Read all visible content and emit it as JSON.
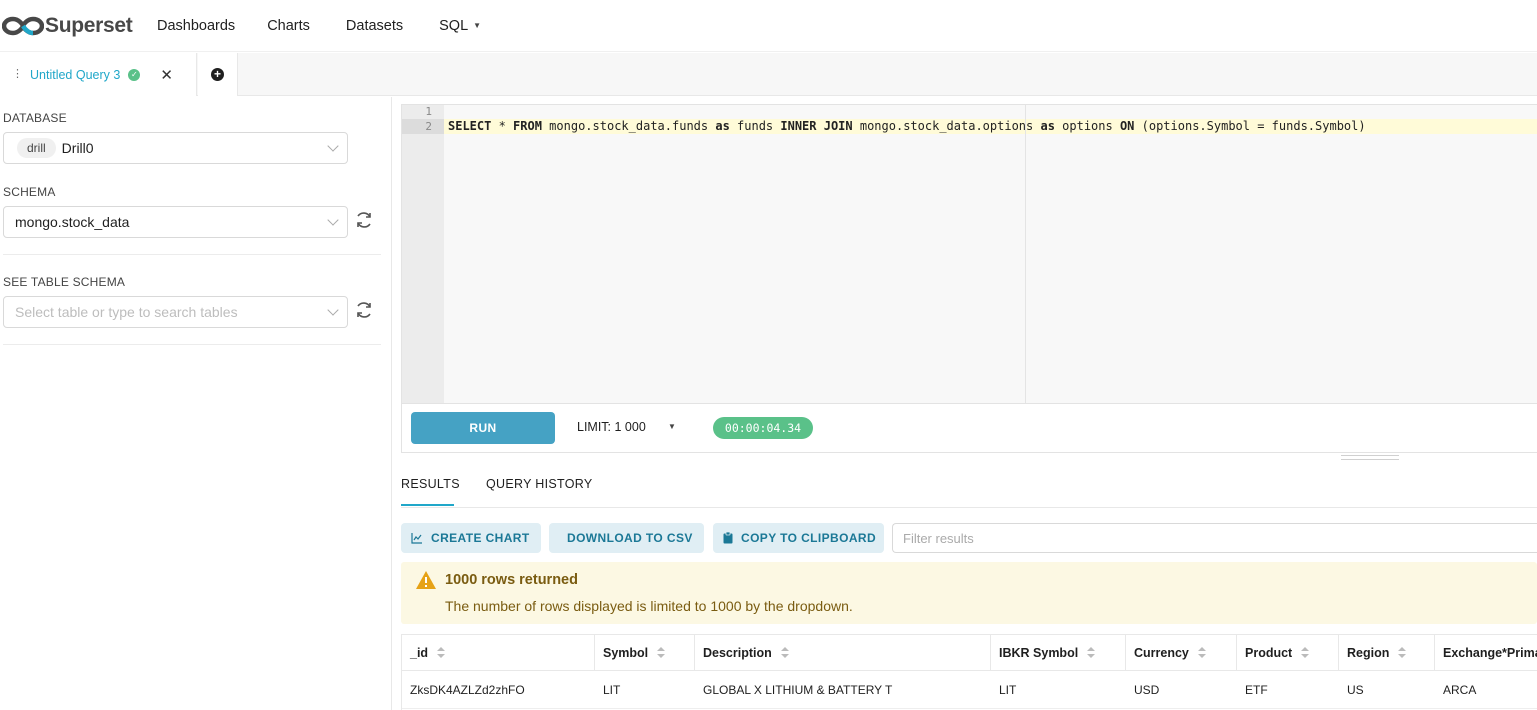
{
  "nav": {
    "brand": "Superset",
    "items": [
      "Dashboards",
      "Charts",
      "Datasets",
      "SQL"
    ]
  },
  "tabs": {
    "query_tab_label": "Untitled Query 3"
  },
  "left": {
    "database_label": "DATABASE",
    "database_tag": "drill",
    "database_name": "Drill0",
    "schema_label": "SCHEMA",
    "schema_value": "mongo.stock_data",
    "table_schema_label": "SEE TABLE SCHEMA",
    "table_placeholder": "Select table or type to search tables"
  },
  "editor": {
    "line_numbers": [
      "1",
      "2"
    ],
    "sql_tokens": [
      {
        "t": "SELECT",
        "kw": true
      },
      {
        "t": " * ",
        "kw": false
      },
      {
        "t": "FROM",
        "kw": true
      },
      {
        "t": " mongo.stock_data.funds ",
        "kw": false
      },
      {
        "t": "as",
        "kw": true
      },
      {
        "t": " funds ",
        "kw": false
      },
      {
        "t": "INNER JOIN",
        "kw": true
      },
      {
        "t": " mongo.stock_data.options ",
        "kw": false
      },
      {
        "t": "as",
        "kw": true
      },
      {
        "t": " options ",
        "kw": false
      },
      {
        "t": "ON",
        "kw": true
      },
      {
        "t": " (options.Symbol = funds.Symbol)",
        "kw": false
      }
    ]
  },
  "runbar": {
    "run_label": "RUN",
    "limit_text": "LIMIT:  1 000",
    "timer": "00:00:04.34"
  },
  "results": {
    "tab_results": "RESULTS",
    "tab_history": "QUERY HISTORY",
    "btn_chart": "CREATE CHART",
    "btn_csv": "DOWNLOAD TO CSV",
    "btn_clipboard": "COPY TO CLIPBOARD",
    "filter_placeholder": "Filter results",
    "alert_title": "1000 rows returned",
    "alert_message": "The number of rows displayed is limited to 1000 by the dropdown.",
    "columns": [
      "_id",
      "Symbol",
      "Description",
      "IBKR Symbol",
      "Currency",
      "Product",
      "Region",
      "Exchange*Primary"
    ],
    "rows": [
      [
        "ZksDK4AZLZd2zhFO",
        "LIT",
        "GLOBAL X LITHIUM & BATTERY T",
        "LIT",
        "USD",
        "ETF",
        "US",
        "ARCA"
      ]
    ]
  },
  "colors": {
    "accent": "#20a7c9",
    "run_button": "#45a2c4",
    "success": "#5ac189",
    "warning_bg": "#fcf8e3",
    "warning_text": "#7a5c11"
  }
}
